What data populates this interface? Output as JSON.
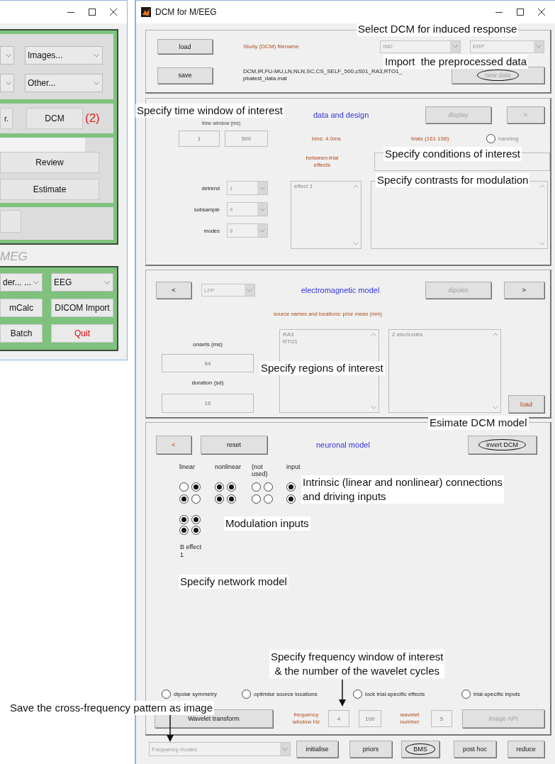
{
  "left_window": {
    "top_dropdowns": [
      {
        "value": "Images..."
      },
      {
        "value": "Other..."
      }
    ],
    "partial_button": "r.",
    "dcm_button": "DCM",
    "dcm_marker": "(2)",
    "mid_buttons": [
      "Review",
      "Estimate"
    ],
    "section_label": "MEG",
    "bottom_controls": [
      {
        "kind": "dropdown",
        "text": "der... ..."
      },
      {
        "kind": "dropdown",
        "text": "EEG"
      },
      {
        "kind": "button",
        "text": "mCalc",
        "color": "#111111"
      },
      {
        "kind": "button",
        "text": "DICOM Import",
        "color": "#111111"
      },
      {
        "kind": "button",
        "text": "Batch",
        "color": "#111111"
      },
      {
        "kind": "button",
        "text": "Quit",
        "color": "#e00000"
      }
    ]
  },
  "dcm_window": {
    "title": "DCM for M/EEG",
    "header": {
      "load_button": {
        "label": "load",
        "disabled": false,
        "circled": false
      },
      "filename_label": "Study (DCM) filename",
      "model_dropdowns": [
        "IND",
        "ERP"
      ],
      "save_button": {
        "label": "save",
        "disabled": false,
        "circled": false
      },
      "filename_lines": [
        "DCM,IR,FU-MU,LN,NLN,SC,CS_SELF_500,cS01_RA3,RTO1_",
        "pbatest_data.mat"
      ],
      "new_data_button": {
        "label": "new data",
        "disabled": true,
        "circled": true
      }
    },
    "data": {
      "title": "data and design",
      "display_button": {
        "label": "display",
        "disabled": true,
        "circled": false
      },
      "next_button": {
        "label": ">",
        "disabled": true,
        "circled": false
      },
      "time_window_label": "time window (ms)",
      "time_window": [
        "1",
        "500"
      ],
      "bins": "bins: 4.0ms",
      "trials": "trials (161  156)",
      "hanning": {
        "label": "hanning",
        "checked": false
      },
      "between_trial_label": "between-trial effects",
      "settings": [
        {
          "label": "detrend",
          "value": "1"
        },
        {
          "label": "subsample",
          "value": "4"
        },
        {
          "label": "modes",
          "value": "8"
        }
      ],
      "effects": [
        "effect 1"
      ]
    },
    "electromagnetic": {
      "back_button": {
        "label": "<",
        "disabled": false,
        "circled": false
      },
      "model_dropdown": "LFP",
      "title": "electromagnetic model",
      "dipoles_button": {
        "label": "dipoles",
        "disabled": true,
        "circled": false
      },
      "next_button": {
        "label": ">",
        "disabled": false,
        "circled": false
      },
      "sources_label": "source names and locations: prior mean (mm)",
      "onsets_label": "onsets (ms)",
      "onsets": "64",
      "duration_label": "duration (sd)",
      "duration": "16",
      "sources": [
        "RA3",
        "RTO1"
      ],
      "electrodes": [
        "2 electrodes"
      ],
      "load_button": {
        "label": "load",
        "disabled": false,
        "circled": false
      }
    },
    "neuronal": {
      "back_button": {
        "label": "<",
        "disabled": false,
        "circled": false
      },
      "reset_button": {
        "label": "reset",
        "disabled": false,
        "circled": false
      },
      "title": "neuronal model",
      "invert_button": {
        "label": "invert DCM",
        "disabled": false,
        "circled": true
      },
      "connection_groups": [
        {
          "label": "linear",
          "rows": [
            [
              {
                "checked": false
              },
              {
                "checked": true
              }
            ],
            [
              {
                "checked": true
              },
              {
                "checked": false
              }
            ]
          ]
        },
        {
          "label": "nonlinear",
          "rows": [
            [
              {
                "checked": true
              },
              {
                "checked": true
              }
            ],
            [
              {
                "checked": true
              },
              {
                "checked": true
              }
            ]
          ]
        },
        {
          "label": "(not used)",
          "rows": [
            [
              {
                "checked": false
              },
              {
                "checked": false
              }
            ],
            [
              {
                "checked": false
              },
              {
                "checked": false
              }
            ]
          ]
        },
        {
          "label": "input",
          "rows": [
            [
              {
                "checked": true
              }
            ],
            [
              {
                "checked": true
              }
            ]
          ]
        }
      ],
      "modulation_rows": [
        [
          {
            "checked": true
          },
          {
            "checked": true
          }
        ],
        [
          {
            "checked": true
          },
          {
            "checked": true
          }
        ]
      ],
      "b_effect_label": "B effect",
      "b_effect_index": "1",
      "options": [
        {
          "label": "dipolar symmetry",
          "checked": false
        },
        {
          "label": "optimise source locations",
          "checked": false
        },
        {
          "label": "lock trial-specific effects",
          "checked": false
        },
        {
          "label": "trial-specific inputs",
          "checked": false
        }
      ],
      "wavelet_button": {
        "label": "Wavelet transform",
        "disabled": false,
        "circled": false
      },
      "frequency_label": "frequency window Hz",
      "frequency_window": [
        "4",
        "100"
      ],
      "wavelet_label": "wavelet number",
      "wavelet_number": "5",
      "image_button": {
        "label": "image API",
        "disabled": true,
        "circled": false
      }
    },
    "footer": {
      "mode_dropdown": "Frequency modes",
      "buttons": [
        {
          "label": "initialise",
          "disabled": false,
          "circled": false
        },
        {
          "label": "priors",
          "disabled": false,
          "circled": false
        },
        {
          "label": "BMS",
          "disabled": false,
          "circled": true
        },
        {
          "label": "post hoc",
          "disabled": false,
          "circled": false
        },
        {
          "label": "reduce",
          "disabled": false,
          "circled": false
        }
      ]
    }
  },
  "annotations": [
    {
      "text": "Select DCM for induced response"
    },
    {
      "text": "Import  the preprocessed data"
    },
    {
      "text": "Specify time window of interest"
    },
    {
      "text": "Specify conditions of interest"
    },
    {
      "text": "Specify contrasts for modulation"
    },
    {
      "text": "Specify regions of interest"
    },
    {
      "text": "Esimate DCM model"
    },
    {
      "text": "Intrinsic (linear and nonlinear) connections\nand driving inputs"
    },
    {
      "text": "Modulation inputs"
    },
    {
      "text": "Specify network model"
    },
    {
      "text": "Specify frequency window of interest\n& the number of the wavelet cycles"
    },
    {
      "text": "Save the cross-frequency pattern as image"
    }
  ]
}
